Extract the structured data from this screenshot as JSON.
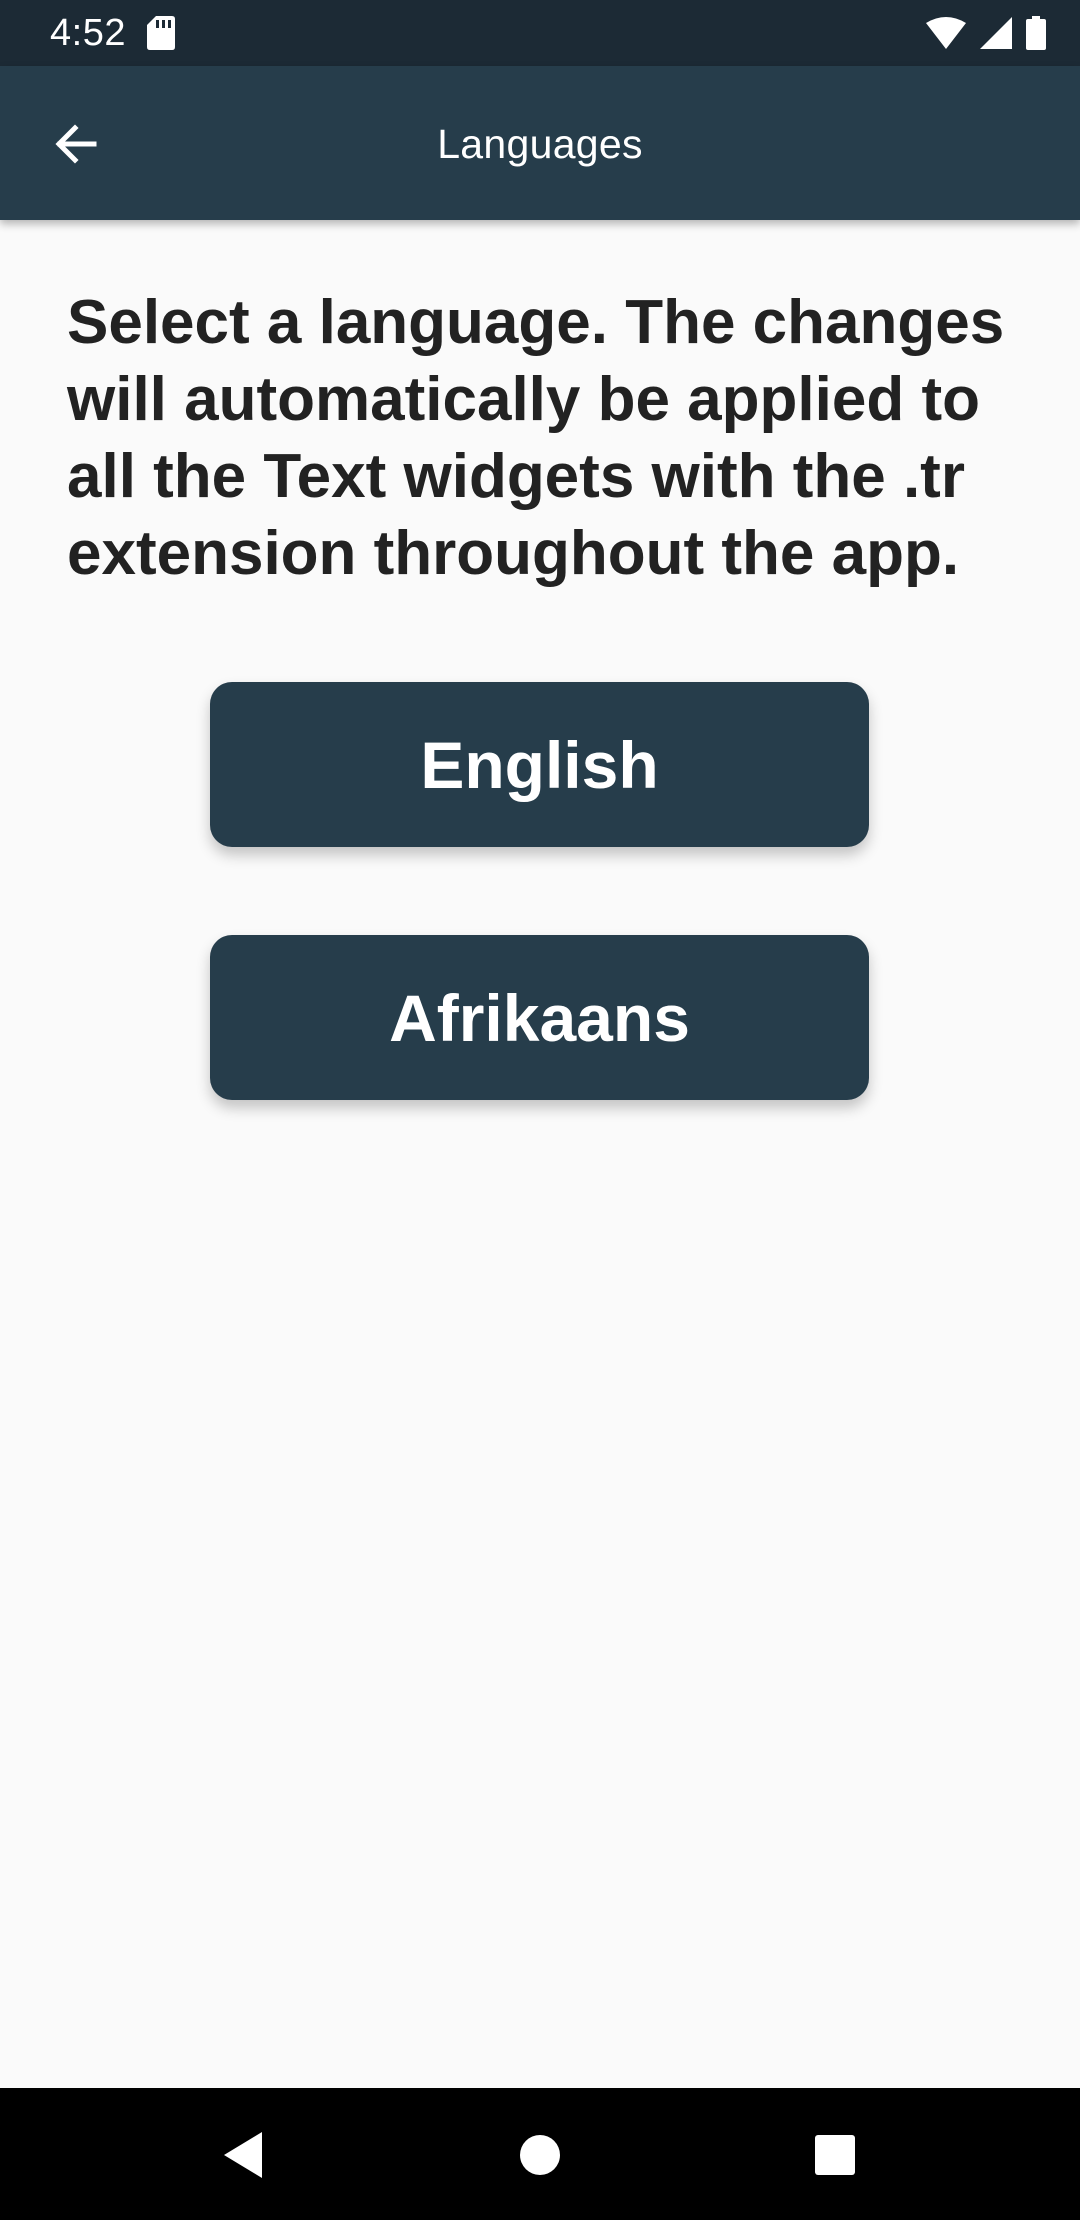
{
  "status_bar": {
    "time": "4:52",
    "icons": [
      "sd-card-icon",
      "wifi-icon",
      "cell-signal-icon",
      "battery-icon"
    ]
  },
  "app_bar": {
    "title": "Languages",
    "back_icon": "arrow-back-icon"
  },
  "main": {
    "description": "Select a language. The changes will automatically be applied to all the Text widgets with the .tr extension throughout the app.",
    "buttons": [
      {
        "label": "English"
      },
      {
        "label": "Afrikaans"
      }
    ]
  },
  "nav_bar": {
    "icons": [
      "nav-back-icon",
      "nav-home-icon",
      "nav-recents-icon"
    ]
  },
  "colors": {
    "status_bar": "#1c2a35",
    "primary": "#263d4b",
    "background": "#fafafa",
    "text": "#222222"
  }
}
